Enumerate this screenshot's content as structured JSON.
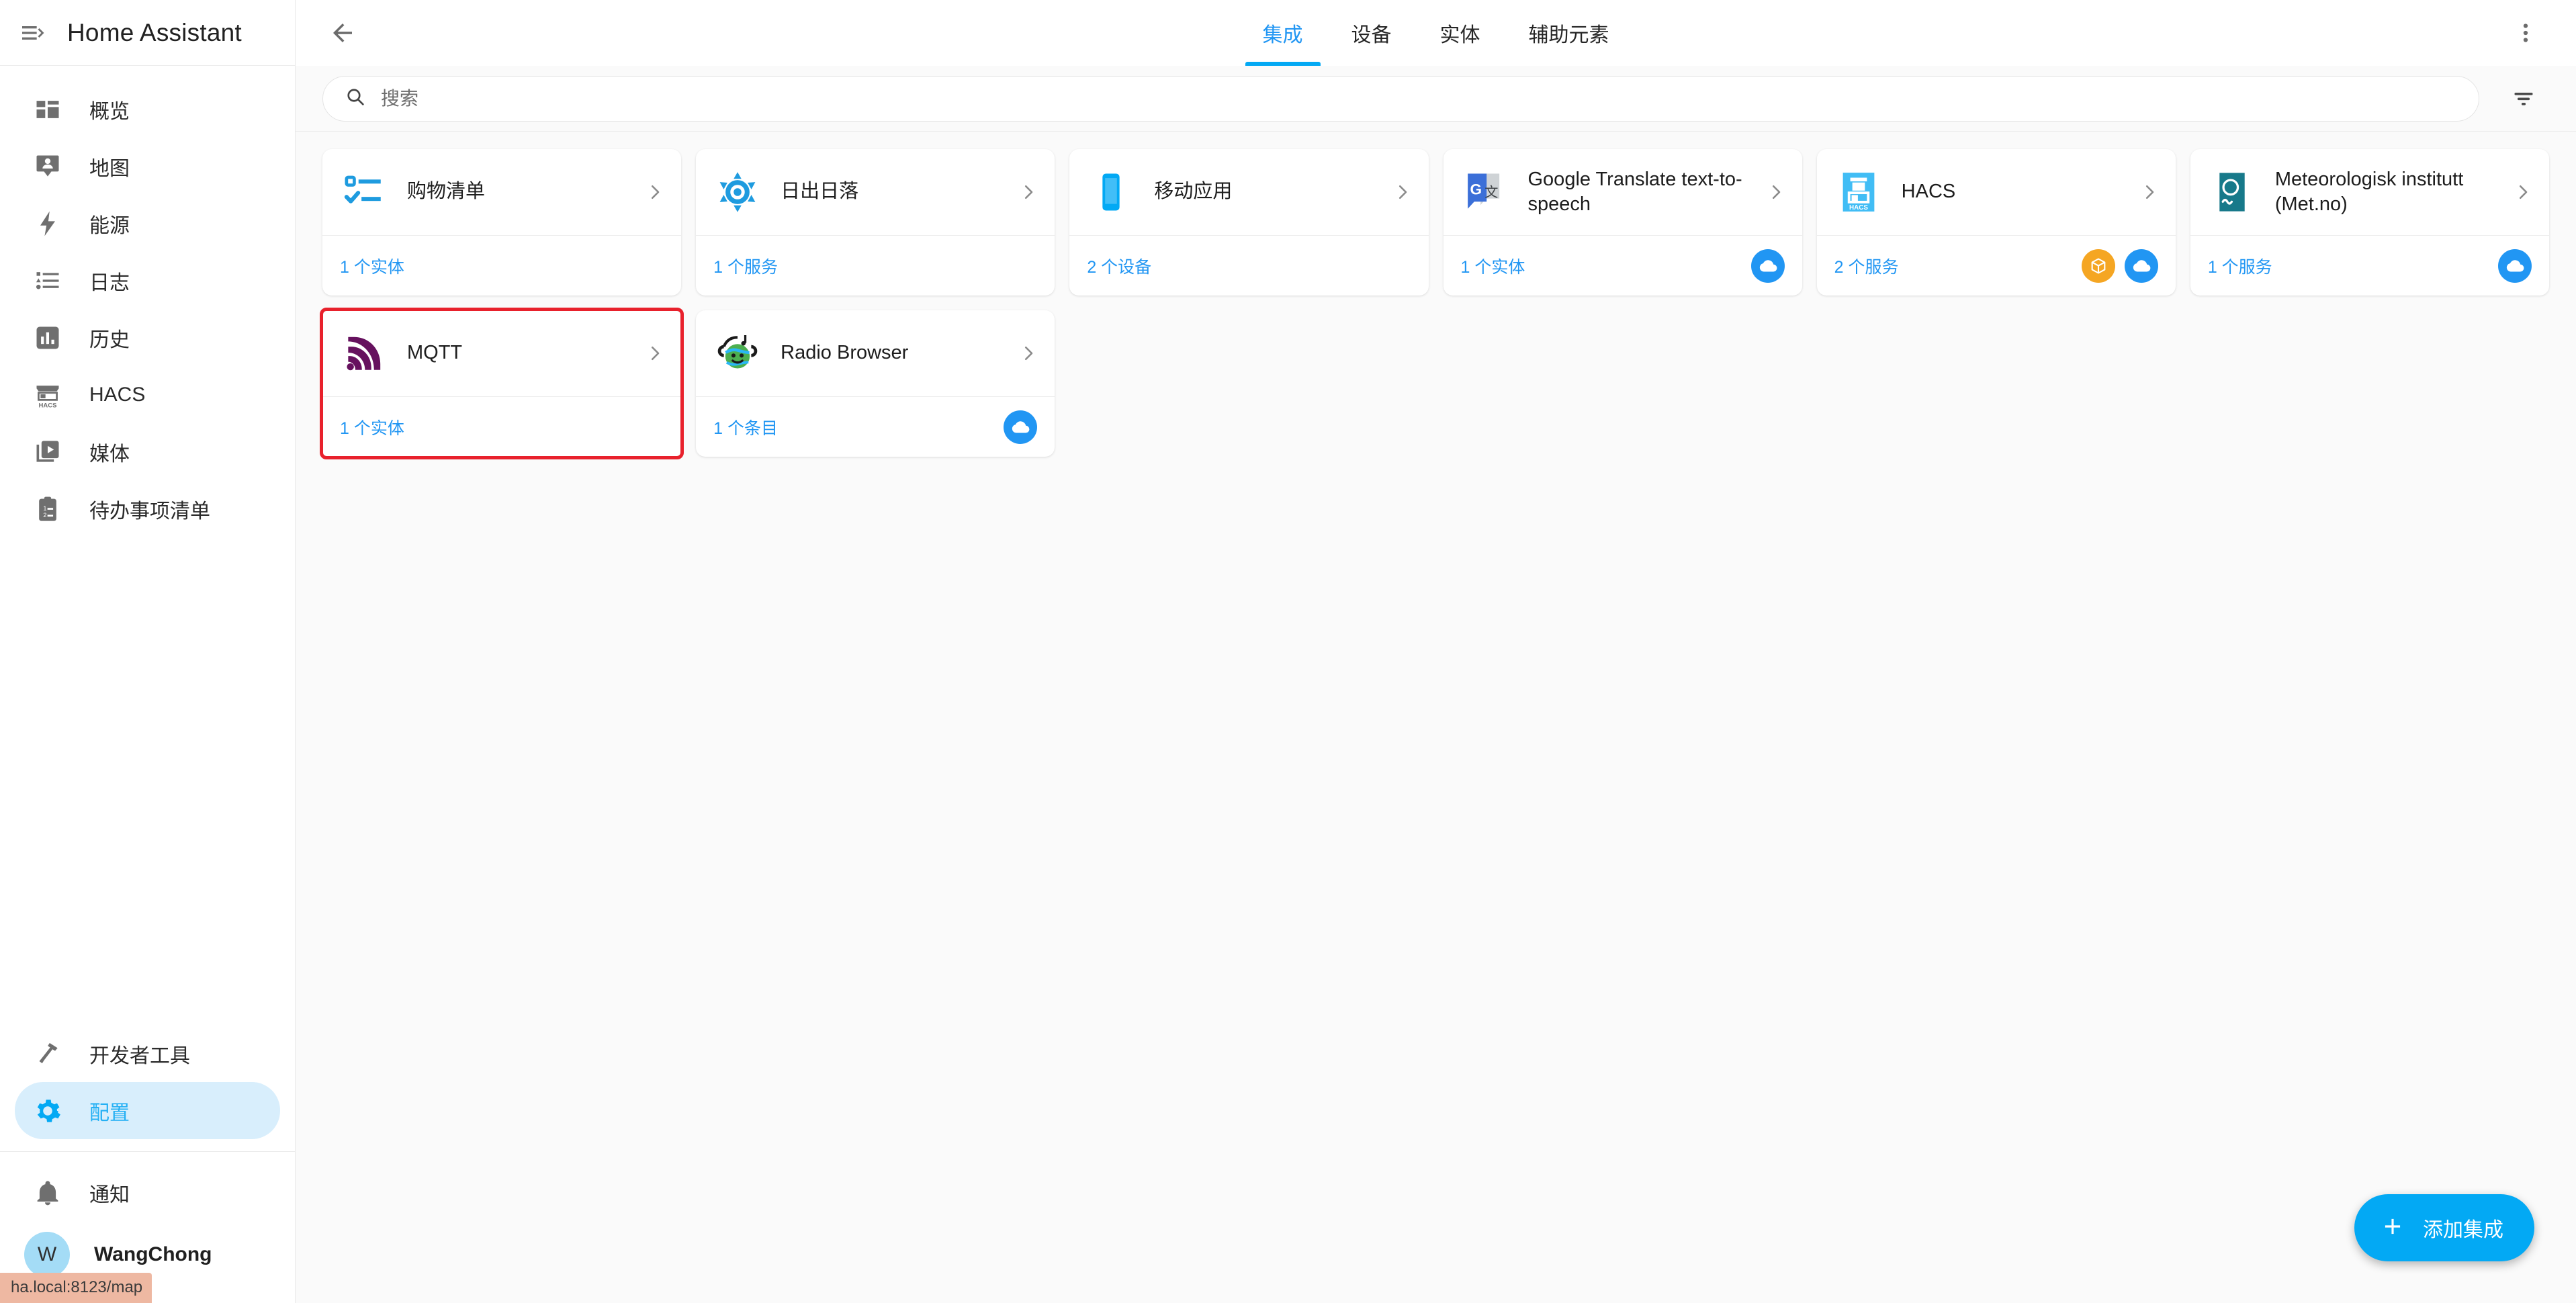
{
  "sidebar": {
    "title": "Home Assistant",
    "menu_icon": "hamburger-collapse-icon",
    "items": [
      {
        "label": "概览",
        "icon": "view-dashboard-icon"
      },
      {
        "label": "地图",
        "icon": "map-marker-account-icon"
      },
      {
        "label": "能源",
        "icon": "lightning-bolt-icon"
      },
      {
        "label": "日志",
        "icon": "format-list-bulleted-icon"
      },
      {
        "label": "历史",
        "icon": "chart-box-icon"
      },
      {
        "label": "HACS",
        "icon": "hacs-storefront-icon"
      },
      {
        "label": "媒体",
        "icon": "play-box-multiple-icon"
      },
      {
        "label": "待办事项清单",
        "icon": "clipboard-list-icon"
      }
    ],
    "bottom_items": [
      {
        "label": "开发者工具",
        "icon": "hammer-icon",
        "active": false
      },
      {
        "label": "配置",
        "icon": "cog-icon",
        "active": true
      }
    ],
    "notifications": {
      "label": "通知",
      "icon": "bell-icon"
    },
    "user": {
      "name": "WangChong",
      "initial": "W"
    },
    "status_text": "ha.local:8123/map"
  },
  "toolbar": {
    "back_icon": "arrow-left-icon",
    "overflow_icon": "dots-vertical-icon",
    "tabs": [
      {
        "label": "集成",
        "active": true
      },
      {
        "label": "设备",
        "active": false
      },
      {
        "label": "实体",
        "active": false
      },
      {
        "label": "辅助元素",
        "active": false
      }
    ]
  },
  "search": {
    "placeholder": "搜索",
    "value": "",
    "icon": "search-icon",
    "filter_icon": "filter-variant-icon"
  },
  "integrations": [
    {
      "name": "购物清单",
      "count": "1 个实体",
      "logo": "shopping-list-icon",
      "badges": [],
      "selected": false
    },
    {
      "name": "日出日落",
      "count": "1 个服务",
      "logo": "sun-icon",
      "badges": [],
      "selected": false
    },
    {
      "name": "移动应用",
      "count": "2 个设备",
      "logo": "mobile-app-icon",
      "badges": [],
      "selected": false
    },
    {
      "name": "Google Translate text-to-speech",
      "count": "1 个实体",
      "logo": "google-translate-icon",
      "badges": [
        "cloud"
      ],
      "selected": false
    },
    {
      "name": "HACS",
      "count": "2 个服务",
      "logo": "hacs-icon",
      "badges": [
        "package",
        "cloud"
      ],
      "selected": false
    },
    {
      "name": "Meteorologisk institutt (Met.no)",
      "count": "1 个服务",
      "logo": "metno-icon",
      "badges": [
        "cloud"
      ],
      "selected": false
    },
    {
      "name": "MQTT",
      "count": "1 个实体",
      "logo": "mqtt-icon",
      "badges": [],
      "selected": true
    },
    {
      "name": "Radio Browser",
      "count": "1 个条目",
      "logo": "radio-browser-icon",
      "badges": [
        "cloud"
      ],
      "selected": false
    }
  ],
  "fab": {
    "label": "添加集成",
    "icon": "plus-icon"
  },
  "colors": {
    "accent": "#03a9f4",
    "link": "#2196f3",
    "selection": "#e8212c",
    "cloud_badge": "#2196f3",
    "package_badge": "#f5a623"
  }
}
